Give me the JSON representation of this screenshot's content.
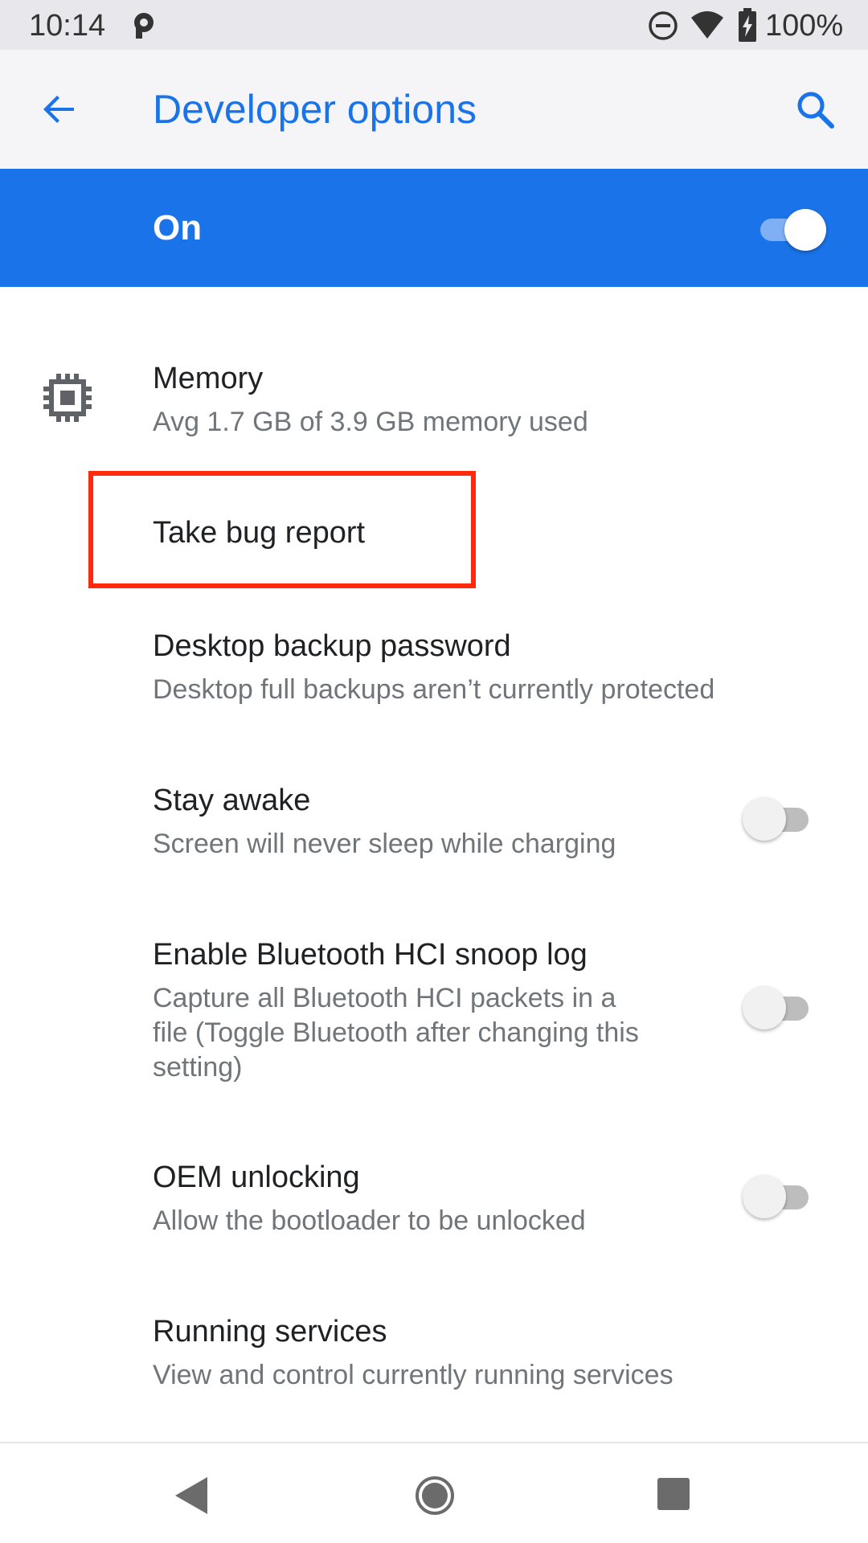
{
  "status_bar": {
    "time": "10:14",
    "battery_text": "100%",
    "icons": [
      "parking-notification-icon",
      "do-not-disturb-icon",
      "wifi-icon",
      "battery-charging-icon"
    ]
  },
  "app_bar": {
    "title": "Developer options",
    "back_icon": "arrow-back-icon",
    "search_icon": "search-icon"
  },
  "master_switch": {
    "label": "On",
    "state": "on"
  },
  "items": [
    {
      "title": "Memory",
      "summary": "Avg 1.7 GB of 3.9 GB memory used",
      "icon": "memory-chip-icon"
    },
    {
      "title": "Take bug report",
      "highlighted": true
    },
    {
      "title": "Desktop backup password",
      "summary": "Desktop full backups aren’t currently protected"
    },
    {
      "title": "Stay awake",
      "summary": "Screen will never sleep while charging",
      "toggle": "off"
    },
    {
      "title": "Enable Bluetooth HCI snoop log",
      "summary_lines": [
        "Capture all Bluetooth HCI packets in a",
        "file (Toggle Bluetooth after changing this",
        "setting)"
      ],
      "toggle": "off"
    },
    {
      "title": "OEM unlocking",
      "summary": "Allow the bootloader to be unlocked",
      "toggle": "off"
    },
    {
      "title": "Running services",
      "summary": "View and control currently running services"
    }
  ],
  "colors": {
    "accent": "#1a73e8",
    "highlight_border": "#ff2a0e",
    "status_bar_bg": "#e8e8ec",
    "app_bar_bg": "#f5f5f8"
  },
  "nav_bar": {
    "icons": [
      "nav-back-icon",
      "nav-home-icon",
      "nav-recents-icon"
    ]
  }
}
